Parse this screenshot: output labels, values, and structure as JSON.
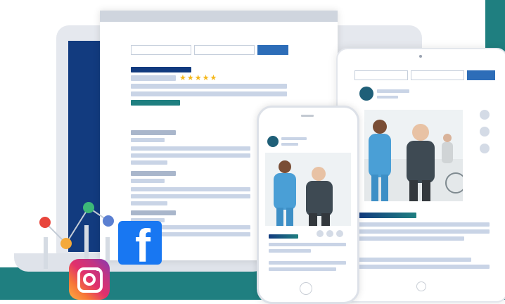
{
  "rating": {
    "stars": "★★★★★",
    "star_color": "#f5b81c"
  },
  "colors": {
    "brand_blue": "#123b7f",
    "teal": "#1f7f80",
    "button_blue": "#2d6db8",
    "placeholder_gray": "#c9d4e6",
    "facebook_blue": "#1877f2"
  },
  "icons": {
    "facebook": "f",
    "instagram": "instagram-icon",
    "analytics": "analytics-graph-icon"
  }
}
